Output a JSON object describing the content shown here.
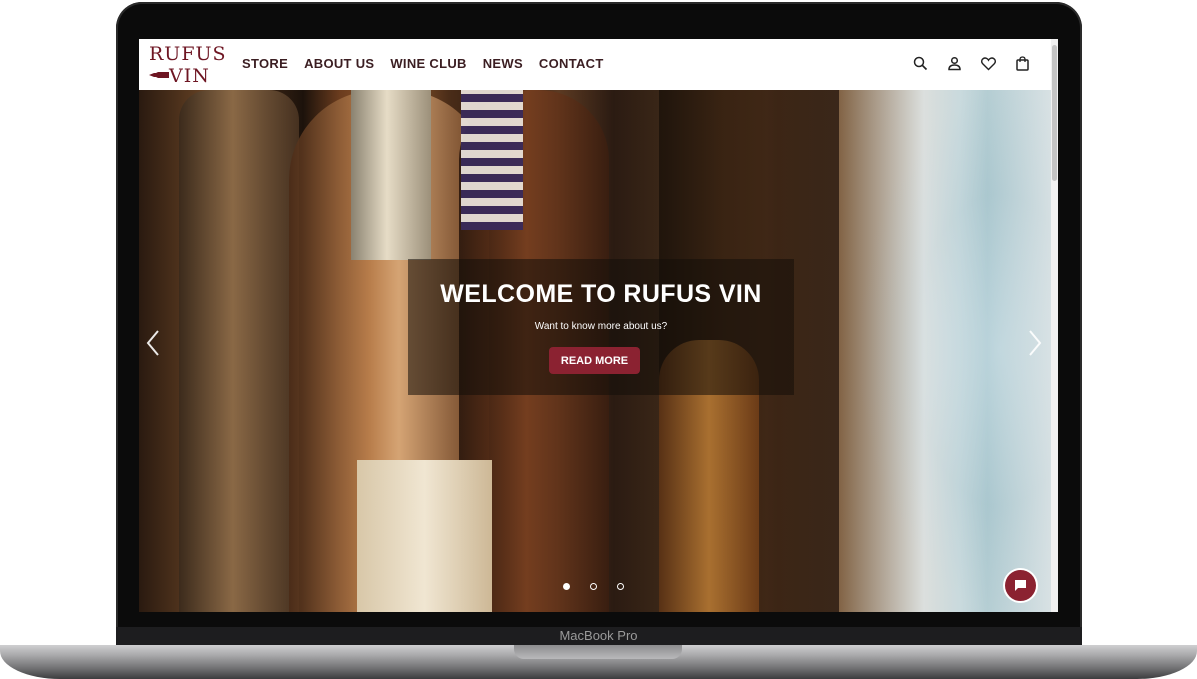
{
  "device": {
    "label": "MacBook Pro"
  },
  "logo": {
    "line1": "RUFUS",
    "line2": "VIN"
  },
  "nav": {
    "items": [
      {
        "label": "STORE"
      },
      {
        "label": "ABOUT US"
      },
      {
        "label": "WINE CLUB"
      },
      {
        "label": "NEWS"
      },
      {
        "label": "CONTACT"
      }
    ],
    "icons": [
      "search-icon",
      "account-icon",
      "heart-icon",
      "shopping-bag-icon"
    ]
  },
  "hero": {
    "title": "WELCOME TO RUFUS VIN",
    "subtitle": "Want to know more about us?",
    "button_label": "READ MORE",
    "slides_total": 3,
    "active_slide": 1
  },
  "colors": {
    "brand": "#8b2231",
    "nav_text": "#3b1e22",
    "logo": "#6e1623"
  }
}
